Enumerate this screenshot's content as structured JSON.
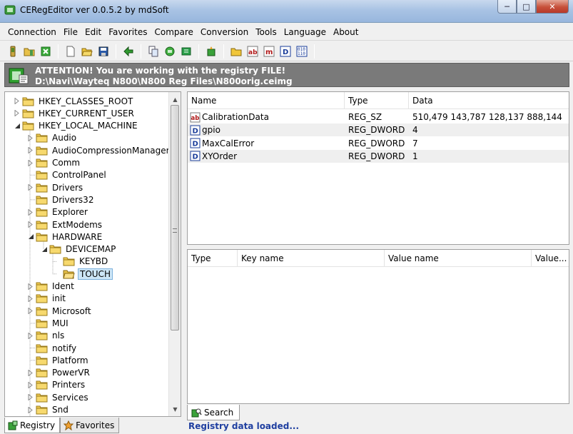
{
  "window": {
    "title": "CERegEditor ver 0.0.5.2 by mdSoft",
    "min": "─",
    "max": "□",
    "close": "✕"
  },
  "menu": [
    "Connection",
    "File",
    "Edit",
    "Favorites",
    "Compare",
    "Conversion",
    "Tools",
    "Language",
    "About"
  ],
  "banner": {
    "line1": "ATTENTION! You are working with the registry FILE!",
    "line2": "D:\\Navi\\Wayteq N800\\N800 Reg Files\\N800orig.ceimg"
  },
  "tree": [
    {
      "label": "HKEY_CLASSES_ROOT",
      "level": 0,
      "exp": "closed"
    },
    {
      "label": "HKEY_CURRENT_USER",
      "level": 0,
      "exp": "closed"
    },
    {
      "label": "HKEY_LOCAL_MACHINE",
      "level": 0,
      "exp": "open"
    },
    {
      "label": "Audio",
      "level": 1,
      "exp": "closed"
    },
    {
      "label": "AudioCompressionManager",
      "level": 1,
      "exp": "closed"
    },
    {
      "label": "Comm",
      "level": 1,
      "exp": "closed"
    },
    {
      "label": "ControlPanel",
      "level": 1,
      "exp": "none"
    },
    {
      "label": "Drivers",
      "level": 1,
      "exp": "closed"
    },
    {
      "label": "Drivers32",
      "level": 1,
      "exp": "none"
    },
    {
      "label": "Explorer",
      "level": 1,
      "exp": "closed"
    },
    {
      "label": "ExtModems",
      "level": 1,
      "exp": "closed"
    },
    {
      "label": "HARDWARE",
      "level": 1,
      "exp": "open"
    },
    {
      "label": "DEVICEMAP",
      "level": 2,
      "exp": "open"
    },
    {
      "label": "KEYBD",
      "level": 3,
      "exp": "none"
    },
    {
      "label": "TOUCH",
      "level": 3,
      "exp": "none",
      "selected": true
    },
    {
      "label": "Ident",
      "level": 1,
      "exp": "closed"
    },
    {
      "label": "init",
      "level": 1,
      "exp": "closed"
    },
    {
      "label": "Microsoft",
      "level": 1,
      "exp": "closed"
    },
    {
      "label": "MUI",
      "level": 1,
      "exp": "none"
    },
    {
      "label": "nls",
      "level": 1,
      "exp": "closed"
    },
    {
      "label": "notify",
      "level": 1,
      "exp": "none"
    },
    {
      "label": "Platform",
      "level": 1,
      "exp": "none"
    },
    {
      "label": "PowerVR",
      "level": 1,
      "exp": "closed"
    },
    {
      "label": "Printers",
      "level": 1,
      "exp": "closed"
    },
    {
      "label": "Services",
      "level": 1,
      "exp": "closed"
    },
    {
      "label": "Snd",
      "level": 1,
      "exp": "closed"
    }
  ],
  "left_tabs": {
    "registry": "Registry",
    "favorites": "Favorites"
  },
  "values_list": {
    "columns": [
      "Name",
      "Type",
      "Data"
    ],
    "rows": [
      {
        "icon": "string-value-icon",
        "name": "CalibrationData",
        "type": "REG_SZ",
        "data": "510,479 143,787 128,137 888,144 887,..."
      },
      {
        "icon": "dword-value-icon",
        "name": "gpio",
        "type": "REG_DWORD",
        "data": "4"
      },
      {
        "icon": "dword-value-icon",
        "name": "MaxCalError",
        "type": "REG_DWORD",
        "data": "7"
      },
      {
        "icon": "dword-value-icon",
        "name": "XYOrder",
        "type": "REG_DWORD",
        "data": "1"
      }
    ]
  },
  "search_list": {
    "columns": [
      "Type",
      "Key name",
      "Value name",
      "Value..."
    ]
  },
  "search_tab": "Search",
  "status": "Registry data loaded..."
}
